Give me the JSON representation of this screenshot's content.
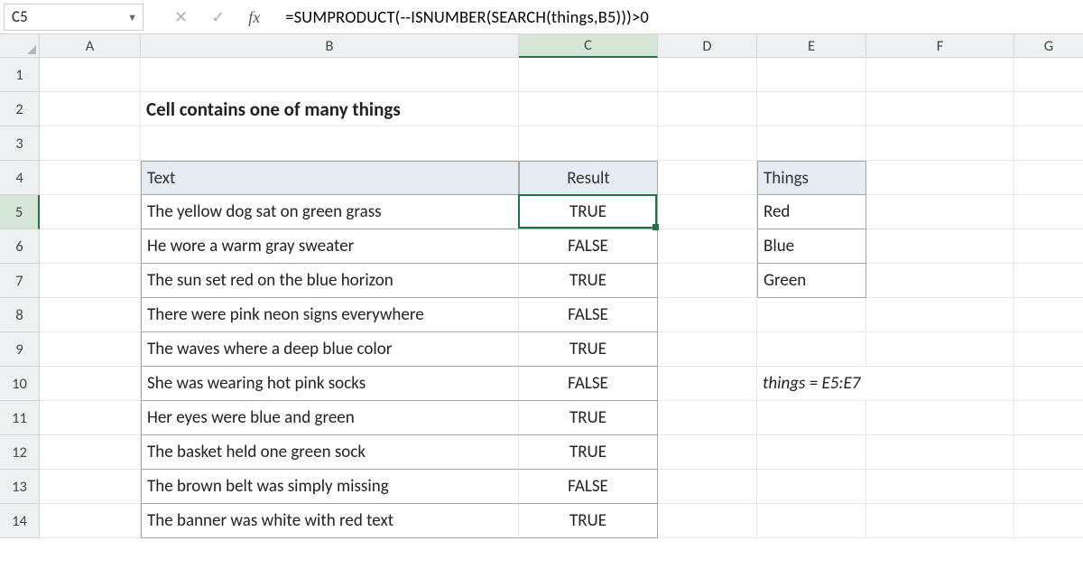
{
  "formula_bar": {
    "cell_ref": "C5",
    "formula": "=SUMPRODUCT(--ISNUMBER(SEARCH(things,B5)))>0"
  },
  "columns": [
    "A",
    "B",
    "C",
    "D",
    "E",
    "F",
    "G"
  ],
  "rows": [
    "1",
    "2",
    "3",
    "4",
    "5",
    "6",
    "7",
    "8",
    "9",
    "10",
    "11",
    "12",
    "13",
    "14"
  ],
  "title": "Cell contains one of many things",
  "headers": {
    "text": "Text",
    "result": "Result",
    "things": "Things"
  },
  "data": [
    {
      "text": "The yellow dog sat on green grass",
      "result": "TRUE"
    },
    {
      "text": "He wore a warm gray sweater",
      "result": "FALSE"
    },
    {
      "text": "The sun set red on the blue horizon",
      "result": "TRUE"
    },
    {
      "text": "There were pink neon signs everywhere",
      "result": "FALSE"
    },
    {
      "text": "The waves where a deep blue color",
      "result": "TRUE"
    },
    {
      "text": "She was wearing hot pink socks",
      "result": "FALSE"
    },
    {
      "text": "Her eyes were blue and green",
      "result": "TRUE"
    },
    {
      "text": "The basket held one green sock",
      "result": "TRUE"
    },
    {
      "text": "The brown belt was simply missing",
      "result": "FALSE"
    },
    {
      "text": "The banner was white with red text",
      "result": "TRUE"
    }
  ],
  "things": [
    "Red",
    "Blue",
    "Green"
  ],
  "note": "things = E5:E7",
  "selected_cell": "C5"
}
